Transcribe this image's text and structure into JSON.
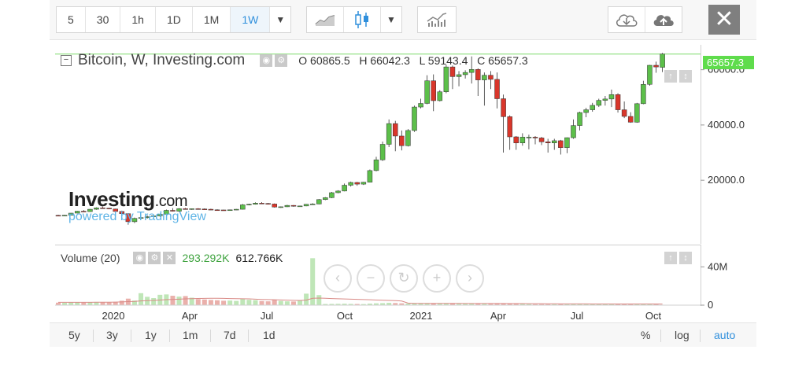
{
  "toolbar": {
    "intervals": [
      "5",
      "30",
      "1h",
      "1D",
      "1M",
      "1W"
    ],
    "active_interval": "1W",
    "close_label": "✕"
  },
  "legend": {
    "symbol": "Bitcoin, W, Investing.com",
    "open_label": "O",
    "open": "60865.5",
    "high_label": "H",
    "high": "66042.3",
    "low_label": "L",
    "low": "59143.4",
    "close_label": "C",
    "close": "65657.3"
  },
  "volume_legend": {
    "label": "Volume (20)",
    "value_green": "293.292K",
    "value_black": "612.766K"
  },
  "last_price_tag": "65657.3",
  "watermark": {
    "brand": "Investing",
    "brand_suffix": ".com",
    "powered": "powered by TradingView"
  },
  "range_buttons": [
    "5y",
    "3y",
    "1y",
    "1m",
    "7d",
    "1d"
  ],
  "scale_buttons": [
    "%",
    "log",
    "auto"
  ],
  "colors": {
    "up": "#5cbf4a",
    "down": "#d9362b",
    "up_volume": "#bfe6b7",
    "down_volume": "#eab0ab",
    "accent": "#2f8fdc",
    "price_tag": "#5fdc4c"
  },
  "chart_data": [
    {
      "type": "candlestick",
      "title": "Bitcoin, W, Investing.com",
      "x_ticks": [
        "2020",
        "Apr",
        "Jul",
        "Oct",
        "2021",
        "Apr",
        "Jul",
        "Oct"
      ],
      "y_ticks": [
        20000,
        40000,
        60000
      ],
      "y_tick_labels": [
        "20000.0",
        "40000.0",
        "60000.0"
      ],
      "ylim": [
        -3000,
        69000
      ],
      "grid": false,
      "candles": [
        [
          7300,
          7500,
          7150,
          7200
        ],
        [
          7200,
          7450,
          7050,
          7350
        ],
        [
          7350,
          8150,
          7300,
          8100
        ],
        [
          8100,
          8900,
          8000,
          8800
        ],
        [
          8800,
          9200,
          8500,
          8650
        ],
        [
          8650,
          9600,
          8600,
          9500
        ],
        [
          9500,
          10200,
          9300,
          10000
        ],
        [
          10000,
          10500,
          9700,
          9900
        ],
        [
          9900,
          10000,
          9500,
          9600
        ],
        [
          9600,
          9700,
          8500,
          8700
        ],
        [
          8700,
          9000,
          7700,
          7900
        ],
        [
          7900,
          8100,
          3900,
          5000
        ],
        [
          5000,
          6500,
          4500,
          6200
        ],
        [
          6200,
          6900,
          5800,
          6500
        ],
        [
          6500,
          7300,
          6100,
          6800
        ],
        [
          6800,
          7300,
          6700,
          7100
        ],
        [
          7100,
          7900,
          6800,
          7700
        ],
        [
          7700,
          9400,
          7600,
          9100
        ],
        [
          9100,
          9900,
          8700,
          8800
        ],
        [
          8800,
          9900,
          8600,
          9700
        ],
        [
          9700,
          10000,
          9400,
          9500
        ],
        [
          9500,
          9800,
          9300,
          9700
        ],
        [
          9700,
          9900,
          9450,
          9600
        ],
        [
          9600,
          9800,
          9400,
          9500
        ],
        [
          9500,
          9700,
          9200,
          9300
        ],
        [
          9300,
          9500,
          9050,
          9250
        ],
        [
          9250,
          9350,
          9100,
          9200
        ],
        [
          9200,
          9400,
          9100,
          9300
        ],
        [
          9300,
          9600,
          9200,
          9500
        ],
        [
          9500,
          11400,
          9400,
          11100
        ],
        [
          11100,
          11500,
          10900,
          11300
        ],
        [
          11300,
          12000,
          11200,
          11700
        ],
        [
          11700,
          12100,
          11500,
          11600
        ],
        [
          11600,
          11800,
          11200,
          11400
        ],
        [
          11400,
          11600,
          10100,
          10300
        ],
        [
          10300,
          10500,
          10000,
          10400
        ],
        [
          10400,
          11100,
          10300,
          10900
        ],
        [
          10900,
          11000,
          10400,
          10600
        ],
        [
          10600,
          10800,
          10500,
          10700
        ],
        [
          10700,
          11400,
          10600,
          11300
        ],
        [
          11300,
          11700,
          11200,
          11400
        ],
        [
          11400,
          13200,
          11300,
          13000
        ],
        [
          13000,
          13900,
          12800,
          13700
        ],
        [
          13700,
          15800,
          13500,
          15500
        ],
        [
          15500,
          16400,
          15300,
          16100
        ],
        [
          16100,
          18800,
          16000,
          18200
        ],
        [
          18200,
          19500,
          17700,
          19200
        ],
        [
          19200,
          19400,
          18000,
          18600
        ],
        [
          18600,
          19400,
          18300,
          19300
        ],
        [
          19300,
          23900,
          19200,
          23500
        ],
        [
          23500,
          28500,
          23200,
          27400
        ],
        [
          27400,
          34000,
          27000,
          33000
        ],
        [
          33000,
          42000,
          32000,
          40500
        ],
        [
          40500,
          41500,
          30500,
          36000
        ],
        [
          36000,
          38000,
          30800,
          32500
        ],
        [
          32500,
          38500,
          32200,
          38000
        ],
        [
          38000,
          47000,
          37500,
          46500
        ],
        [
          46500,
          49500,
          46000,
          47800
        ],
        [
          47800,
          58000,
          47500,
          56000
        ],
        [
          56000,
          58300,
          45000,
          48800
        ],
        [
          48800,
          52600,
          48500,
          52000
        ],
        [
          52000,
          61800,
          51500,
          61000
        ],
        [
          61000,
          61500,
          53000,
          57500
        ],
        [
          57500,
          59500,
          54000,
          58200
        ],
        [
          58200,
          59800,
          56800,
          59000
        ],
        [
          59000,
          64800,
          55000,
          60100
        ],
        [
          60100,
          60500,
          50500,
          56300
        ],
        [
          56300,
          59000,
          47000,
          58000
        ],
        [
          58000,
          59500,
          53000,
          56500
        ],
        [
          56500,
          59000,
          46000,
          49500
        ],
        [
          49500,
          51000,
          30000,
          43000
        ],
        [
          43000,
          43500,
          31000,
          35700
        ],
        [
          35700,
          36000,
          31000,
          33500
        ],
        [
          33500,
          37000,
          32500,
          35600
        ],
        [
          35600,
          36500,
          31200,
          35600
        ],
        [
          35600,
          36000,
          33000,
          35300
        ],
        [
          35300,
          35700,
          32700,
          33900
        ],
        [
          33900,
          35000,
          30000,
          33500
        ],
        [
          33500,
          35000,
          31000,
          34300
        ],
        [
          34300,
          34600,
          29300,
          31800
        ],
        [
          31800,
          35500,
          29800,
          35400
        ],
        [
          35400,
          42000,
          35000,
          39800
        ],
        [
          39800,
          44800,
          38000,
          44500
        ],
        [
          44500,
          46200,
          42800,
          45500
        ],
        [
          45500,
          48000,
          44800,
          47100
        ],
        [
          47100,
          49500,
          46500,
          48900
        ],
        [
          48900,
          50500,
          47000,
          49400
        ],
        [
          49400,
          52800,
          46500,
          51000
        ],
        [
          51000,
          51500,
          44500,
          45500
        ],
        [
          45500,
          48500,
          42500,
          43100
        ],
        [
          43100,
          44600,
          40800,
          41000
        ],
        [
          41000,
          48000,
          40800,
          47700
        ],
        [
          47700,
          56000,
          47500,
          54700
        ],
        [
          54700,
          61700,
          54200,
          61600
        ],
        [
          61600,
          62900,
          58900,
          61000
        ],
        [
          60865.5,
          66042.3,
          59143.4,
          65657.3
        ]
      ],
      "volume_ylim": [
        0,
        55
      ],
      "volume_y_ticks": [
        0,
        40
      ],
      "volume_y_tick_labels": [
        "0",
        "40M"
      ],
      "volume_m": [
        2.6,
        2.4,
        2.8,
        3.0,
        2.7,
        2.9,
        3.2,
        3.0,
        2.8,
        3.4,
        4.6,
        6.8,
        4.8,
        12.5,
        8.7,
        7.4,
        10.8,
        11.2,
        9.8,
        8.9,
        9.5,
        7.8,
        6.3,
        5.9,
        5.4,
        5.1,
        4.6,
        4.8,
        4.4,
        6.7,
        5.6,
        5.2,
        4.3,
        4.0,
        5.5,
        4.4,
        4.0,
        3.8,
        5.2,
        12.0,
        49.0,
        10.5,
        1.2,
        1.3,
        1.4,
        1.5,
        1.3,
        1.2,
        1.1,
        1.6,
        1.9,
        2.1,
        2.4,
        2.2,
        1.9,
        1.7,
        1.8,
        1.6,
        1.9,
        1.7,
        1.5,
        1.6,
        1.7,
        1.4,
        1.5,
        1.6,
        1.5,
        1.4,
        1.3,
        1.7,
        2.0,
        1.6,
        1.3,
        1.2,
        1.1,
        1.0,
        1.0,
        1.0,
        1.0,
        1.1,
        1.0,
        1.2,
        1.3,
        1.1,
        1.0,
        1.0,
        1.1,
        1.2,
        1.3,
        1.2,
        1.1,
        1.0,
        1.1,
        1.3,
        1.2,
        0.3
      ],
      "volume_ma_m": [
        3.0,
        3.0,
        3.0,
        3.0,
        3.0,
        3.0,
        3.1,
        3.1,
        3.1,
        3.2,
        3.4,
        3.7,
        3.9,
        4.4,
        4.7,
        4.9,
        5.3,
        5.7,
        6.0,
        6.3,
        6.6,
        6.8,
        7.0,
        7.1,
        7.2,
        7.2,
        7.1,
        6.9,
        6.8,
        6.7,
        6.6,
        6.3,
        6.0,
        5.8,
        5.6,
        5.4,
        5.2,
        5.0,
        4.9,
        5.2,
        7.2,
        7.4,
        7.2,
        6.9,
        6.7,
        6.5,
        6.3,
        6.1,
        5.9,
        5.6,
        5.3,
        5.1,
        4.9,
        4.7,
        4.3,
        2.2,
        1.8,
        1.8,
        1.8,
        1.8,
        1.8,
        1.8,
        1.8,
        1.8,
        1.7,
        1.7,
        1.7,
        1.7,
        1.7,
        1.7,
        1.7,
        1.6,
        1.6,
        1.6,
        1.5,
        1.5,
        1.5,
        1.4,
        1.4,
        1.3,
        1.3,
        1.3,
        1.3,
        1.3,
        1.2,
        1.2,
        1.2,
        1.2,
        1.2,
        1.2,
        1.2,
        1.2,
        1.2,
        1.2,
        1.2,
        1.1
      ]
    }
  ]
}
